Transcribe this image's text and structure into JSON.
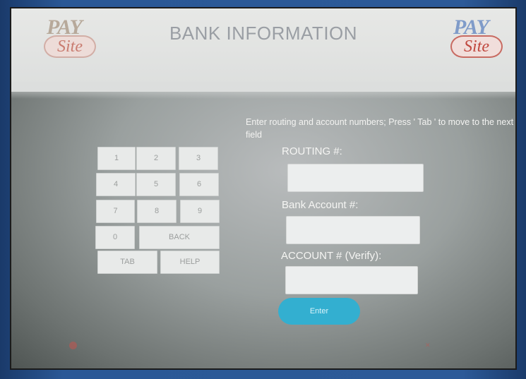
{
  "header": {
    "title": "BANK INFORMATION",
    "logo_left": {
      "word_top": "PAY",
      "word_bottom": "Site"
    },
    "logo_right": {
      "word_top": "PAY",
      "word_bottom": "Site"
    }
  },
  "instructions": "Enter routing and account numbers; Press ' Tab ' to move to the next field",
  "keypad": {
    "keys": [
      "1",
      "2",
      "3",
      "4",
      "5",
      "6",
      "7",
      "8",
      "9",
      "0",
      "BACK",
      "TAB",
      "HELP"
    ]
  },
  "form": {
    "routing_label": "ROUTING #:",
    "routing_value": "",
    "account_label": "Bank Account #:",
    "account_value": "",
    "verify_label": "ACCOUNT # (Verify):",
    "verify_value": "",
    "enter_label": "Enter"
  },
  "colors": {
    "accent_button": "#33afd0",
    "footer_text": "#c4534f"
  },
  "icons": {
    "footer_left": "language-icon",
    "footer_right": "close-icon"
  }
}
